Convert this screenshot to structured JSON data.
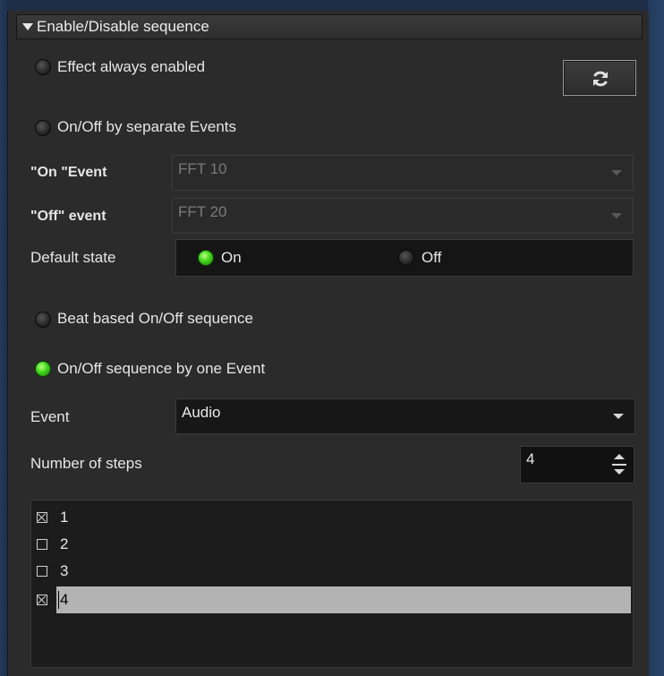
{
  "header": {
    "title": "Enable/Disable sequence"
  },
  "options": {
    "always_enabled": "Effect always enabled",
    "separate_events": "On/Off by separate Events",
    "beat_based": "Beat based On/Off sequence",
    "one_event": "On/Off sequence by one Event"
  },
  "on_event": {
    "label": "\"On \"Event",
    "value": "FFT 10"
  },
  "off_event": {
    "label": "\"Off\" event",
    "value": "FFT 20"
  },
  "default_state": {
    "label": "Default state",
    "on_label": "On",
    "off_label": "Off",
    "selected": "On"
  },
  "event": {
    "label": "Event",
    "value": "Audio"
  },
  "num_steps": {
    "label": "Number of steps",
    "value": "4"
  },
  "steps": [
    {
      "label": "1",
      "checked": true,
      "selected": false
    },
    {
      "label": "2",
      "checked": false,
      "selected": false
    },
    {
      "label": "3",
      "checked": false,
      "selected": false
    },
    {
      "label": "4",
      "checked": true,
      "selected": true
    }
  ],
  "selected_mode": "one_event",
  "colors": {
    "radio_on": "#3fd41c",
    "panel_bg": "#2b2b2b",
    "selection": "#b3b3b3"
  }
}
